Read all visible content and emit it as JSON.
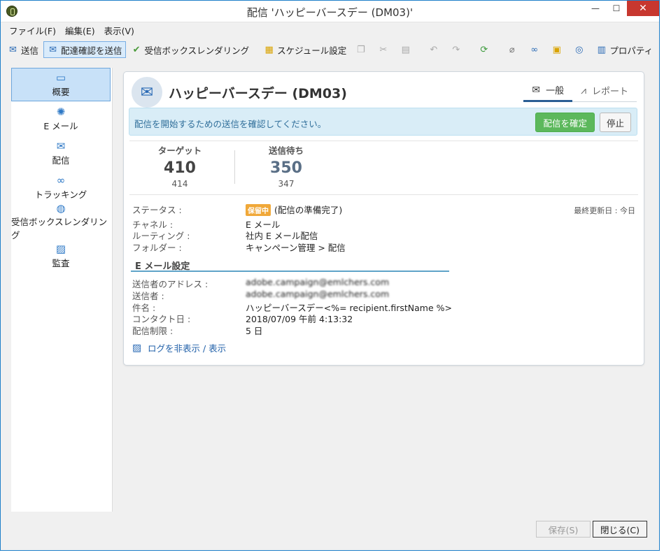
{
  "window": {
    "title": "配信 'ハッピーバースデー (DM03)'",
    "min": "—",
    "max": "☐",
    "close": "✕"
  },
  "menu": [
    "ファイル(F)",
    "編集(E)",
    "表示(V)"
  ],
  "toolbar": {
    "send": "送信",
    "send_proof": "配達確認を送信",
    "inbox_render": "受信ボックスレンダリング",
    "schedule": "スケジュール設定",
    "properties": "プロパティ"
  },
  "sidebar": [
    {
      "label": "概要",
      "icon": "overview-icon"
    },
    {
      "label": "E メール",
      "icon": "email-icon"
    },
    {
      "label": "配信",
      "icon": "delivery-icon"
    },
    {
      "label": "トラッキング",
      "icon": "tracking-icon"
    },
    {
      "label": "受信ボックスレンダリング",
      "icon": "globe-icon"
    },
    {
      "label": "監査",
      "icon": "audit-icon"
    }
  ],
  "card": {
    "title": "ハッピーバースデー (DM03)",
    "tabs": {
      "general": "一般",
      "report": "レポート"
    },
    "banner": {
      "message": "配信を開始するための送信を確認してください。",
      "confirm": "配信を確定",
      "stop": "停止"
    },
    "stats": {
      "target_label": "ターゲット",
      "target_value": "410",
      "target_sub": "414",
      "pending_label": "送信待ち",
      "pending_value": "350",
      "pending_sub": "347"
    },
    "details": {
      "status_label": "ステータス :",
      "status_badge": "保留中",
      "status_value": "(配信の準備完了)",
      "updated": "最終更新日 : 今日",
      "channel_label": "チャネル :",
      "channel_value": "E メール",
      "routing_label": "ルーティング :",
      "routing_value": "社内 E メール配信",
      "folder_label": "フォルダー :",
      "folder_value": "キャンペーン管理 > 配信"
    },
    "email_settings": {
      "title": "E メール設定",
      "from_addr_label": "送信者のアドレス :",
      "from_addr_value": "adobe.campaign@emlchers.com",
      "from_label": "送信者 :",
      "from_value": "adobe.campaign@emlchers.com",
      "subject_label": "件名 :",
      "subject_value": "ハッピーバースデー<%= recipient.firstName %>",
      "contact_label": "コンタクト日 :",
      "contact_value": "2018/07/09 午前 4:13:32",
      "limit_label": "配信制限 :",
      "limit_value": "5 日"
    },
    "log_link": "ログを非表示 / 表示"
  },
  "footer": {
    "save": "保存(S)",
    "close": "閉じる(C)"
  },
  "colors": {
    "accent": "#2a6ab5",
    "confirm": "#5cb85c",
    "badge": "#f0a839",
    "banner": "#d9edf7"
  }
}
